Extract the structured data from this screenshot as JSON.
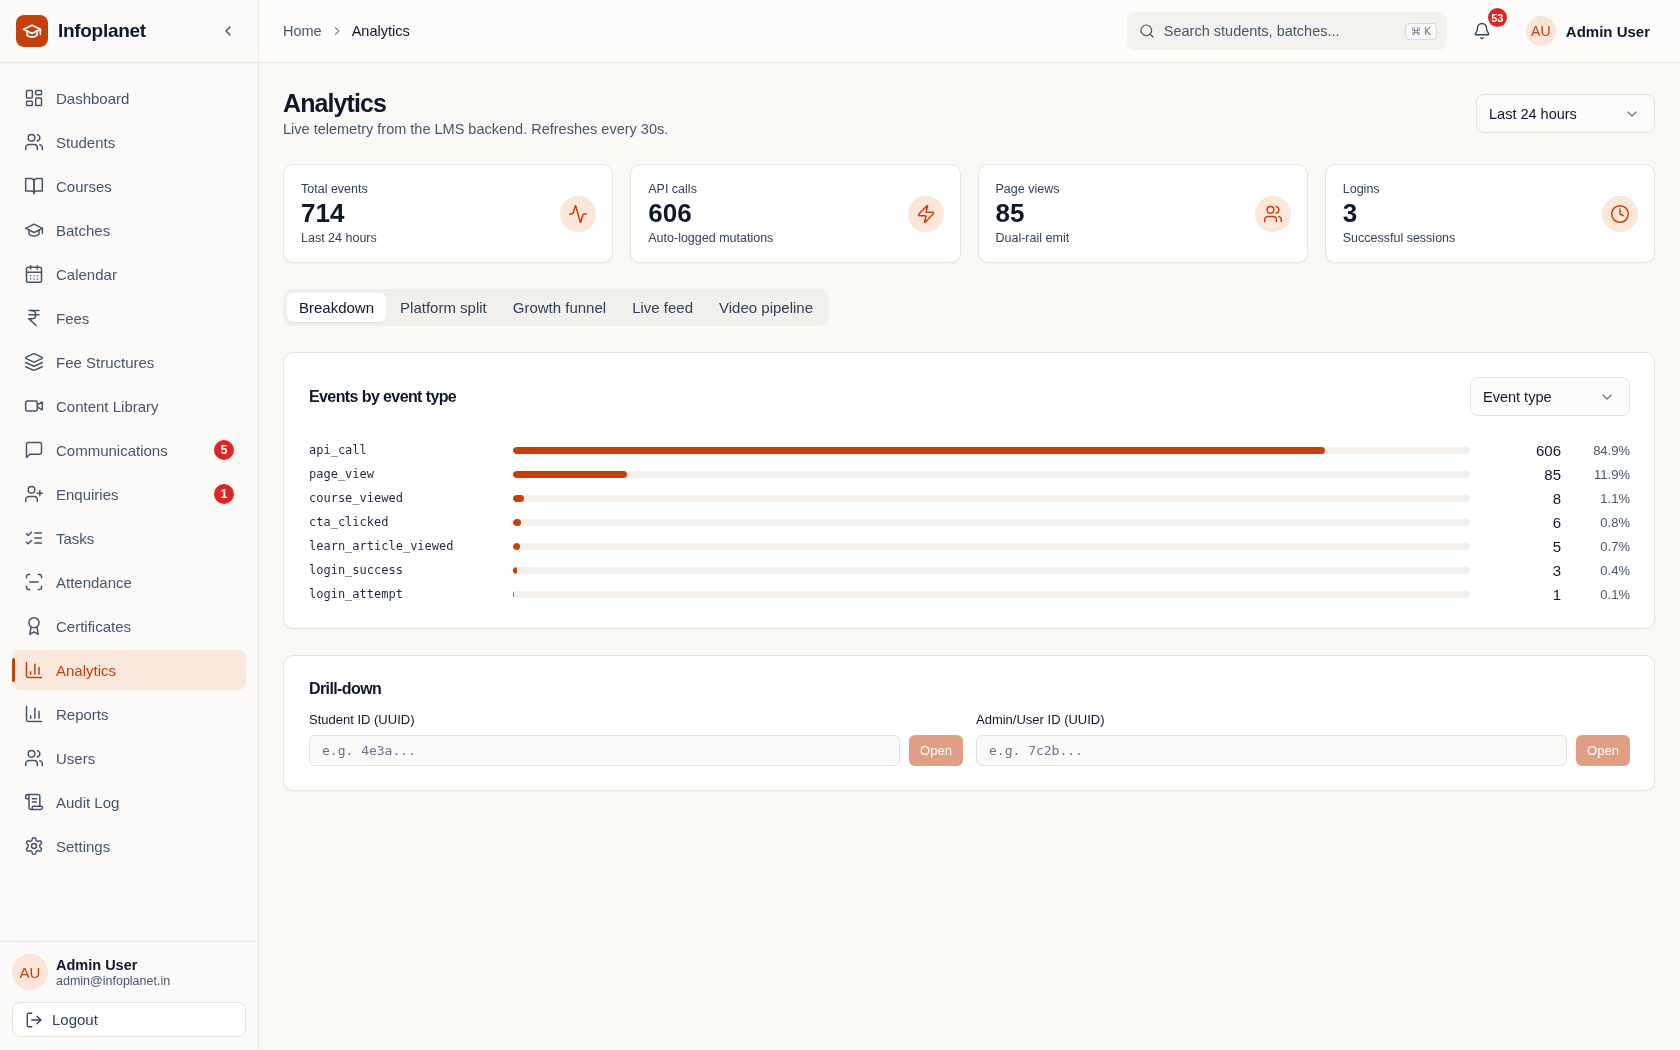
{
  "app": {
    "name": "Infoplanet"
  },
  "sidebar": {
    "items": [
      {
        "label": "Dashboard",
        "selected": false
      },
      {
        "label": "Students",
        "selected": false
      },
      {
        "label": "Courses",
        "selected": false
      },
      {
        "label": "Batches",
        "selected": false
      },
      {
        "label": "Calendar",
        "selected": false
      },
      {
        "label": "Fees",
        "selected": false
      },
      {
        "label": "Fee Structures",
        "selected": false
      },
      {
        "label": "Content Library",
        "selected": false
      },
      {
        "label": "Communications",
        "selected": false,
        "badge": "5"
      },
      {
        "label": "Enquiries",
        "selected": false,
        "badge": "1"
      },
      {
        "label": "Tasks",
        "selected": false
      },
      {
        "label": "Attendance",
        "selected": false
      },
      {
        "label": "Certificates",
        "selected": false
      },
      {
        "label": "Analytics",
        "selected": true
      },
      {
        "label": "Reports",
        "selected": false
      },
      {
        "label": "Users",
        "selected": false
      },
      {
        "label": "Audit Log",
        "selected": false
      },
      {
        "label": "Settings",
        "selected": false
      }
    ],
    "user": {
      "initials": "AU",
      "name": "Admin User",
      "email": "admin@infoplanet.in"
    },
    "logout": "Logout"
  },
  "header": {
    "breadcrumb": [
      "Home",
      "Analytics"
    ],
    "search": {
      "placeholder": "Search students, batches...",
      "shortcut": "⌘ K"
    },
    "notifications": "53",
    "user": {
      "initials": "AU",
      "name": "Admin User"
    }
  },
  "page": {
    "title": "Analytics",
    "subtitle": "Live telemetry from the LMS backend. Refreshes every 30s.",
    "range": "Last 24 hours"
  },
  "stats": [
    {
      "label": "Total events",
      "value": "714",
      "note": "Last 24 hours"
    },
    {
      "label": "API calls",
      "value": "606",
      "note": "Auto-logged mutations"
    },
    {
      "label": "Page views",
      "value": "85",
      "note": "Dual-rail emit"
    },
    {
      "label": "Logins",
      "value": "3",
      "note": "Successful sessions"
    }
  ],
  "tabs": [
    {
      "label": "Breakdown",
      "selected": true
    },
    {
      "label": "Platform split",
      "selected": false
    },
    {
      "label": "Growth funnel",
      "selected": false
    },
    {
      "label": "Live feed",
      "selected": false
    },
    {
      "label": "Video pipeline",
      "selected": false
    }
  ],
  "breakdown": {
    "title": "Events by event type",
    "group_by": "Event type",
    "rows": [
      {
        "name": "api_call",
        "count": "606",
        "share": "84.9%",
        "level": 0.849
      },
      {
        "name": "page_view",
        "count": "85",
        "share": "11.9%",
        "level": 0.119
      },
      {
        "name": "course_viewed",
        "count": "8",
        "share": "1.1%",
        "level": 0.011
      },
      {
        "name": "cta_clicked",
        "count": "6",
        "share": "0.8%",
        "level": 0.008
      },
      {
        "name": "learn_article_viewed",
        "count": "5",
        "share": "0.7%",
        "level": 0.007
      },
      {
        "name": "login_success",
        "count": "3",
        "share": "0.4%",
        "level": 0.004
      },
      {
        "name": "login_attempt",
        "count": "1",
        "share": "0.1%",
        "level": 0.001
      }
    ]
  },
  "drilldown": {
    "title": "Drill-down",
    "fields": [
      {
        "label": "Student ID (UUID)",
        "placeholder": "e.g. 4e3a...",
        "button": "Open",
        "disabled": true
      },
      {
        "label": "Admin/User ID (UUID)",
        "placeholder": "e.g. 7c2b...",
        "button": "Open",
        "disabled": true
      }
    ]
  }
}
